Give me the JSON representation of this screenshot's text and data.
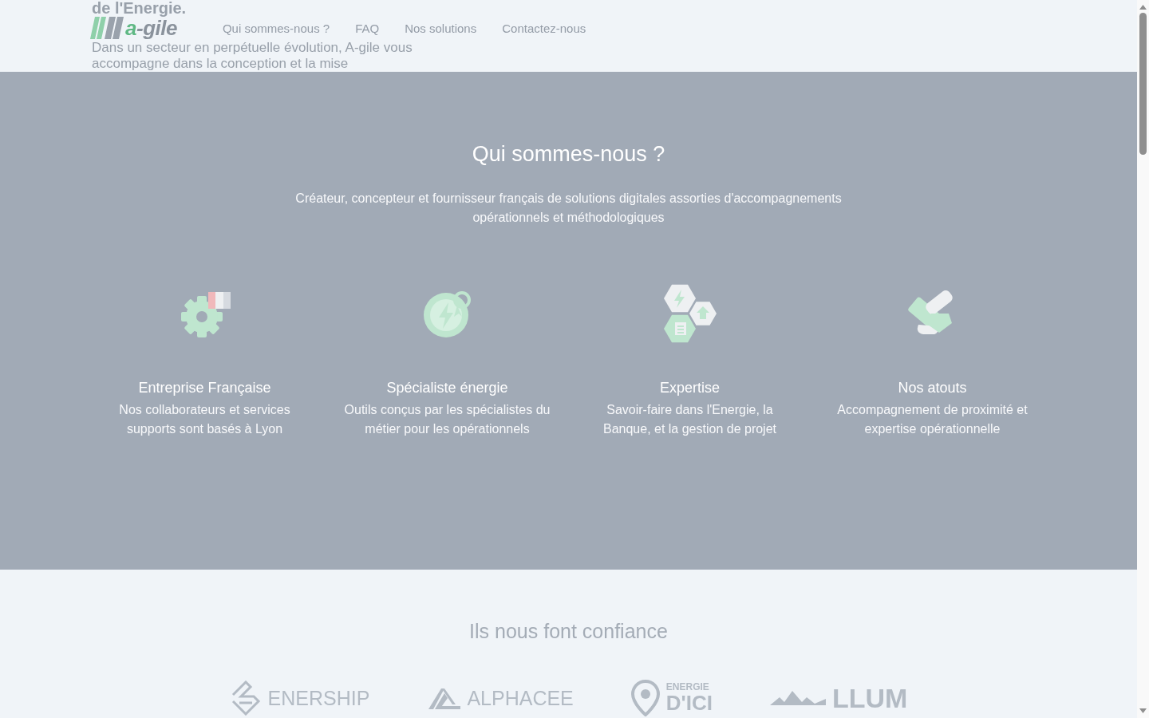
{
  "hero": {
    "title": "de l'Energie.",
    "text": "Dans un secteur en perpétuelle évolution, A-gile vous accompagne dans la conception et la mise"
  },
  "header": {
    "logo": {
      "text": "a-gile"
    },
    "nav": [
      {
        "label": "Qui sommes-nous ?"
      },
      {
        "label": "FAQ"
      },
      {
        "label": "Nos solutions"
      },
      {
        "label": "Contactez-nous"
      }
    ]
  },
  "about": {
    "title": "Qui sommes-nous ?",
    "subtitle": "Créateur, concepteur et fournisseur français de solutions digitales assorties d'accompagnements opérationnels et méthodologiques",
    "features": [
      {
        "kind": "gear-flag",
        "title": "Entreprise Française",
        "text": "Nos collaborateurs et services supports sont basés à Lyon"
      },
      {
        "kind": "bolt-badge",
        "title": "Spécialiste énergie",
        "text": "Outils conçus par les spécialistes du métier pour les opérationnels"
      },
      {
        "kind": "hexagons",
        "title": "Expertise",
        "text": "Savoir-faire dans l'Energie, la Banque, et la gestion de projet"
      },
      {
        "kind": "handshake",
        "title": "Nos atouts",
        "text": "Accompagnement de proximité et expertise opérationnelle"
      }
    ]
  },
  "partners": {
    "title": "Ils nous font confiance",
    "logos": [
      {
        "kind": "stripes",
        "texts": [
          "ENERSHIP"
        ]
      },
      {
        "kind": "triangle",
        "texts": [
          "ALPHACEE"
        ]
      },
      {
        "kind": "pin",
        "texts": [
          "ENERGIE",
          "D'ICI"
        ]
      },
      {
        "kind": "mountains",
        "texts": [
          "LLUM"
        ]
      }
    ]
  }
}
